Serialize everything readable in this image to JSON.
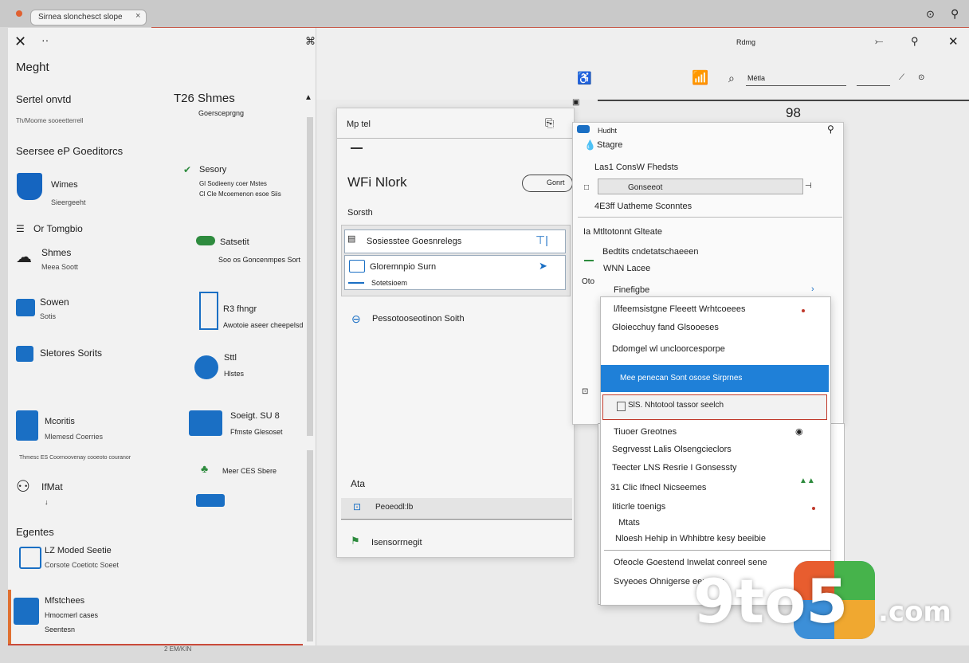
{
  "browser": {
    "tab_title": "Sirnea slonchesct slope"
  },
  "window": {
    "left_title": "Meght",
    "center_title": "Rdmg",
    "search_field": "Métla",
    "right_number": "98"
  },
  "left": {
    "section1_title": "Sertel onvtd",
    "section1_sub": "Th/Moome sooeetterrell",
    "section2_title": "Seersee eP Goeditorcs",
    "items": [
      {
        "title": "Wimes",
        "sub": "Sieergeeht"
      },
      {
        "title": "Or Tomgbio",
        "sub": ""
      },
      {
        "title": "Shmes",
        "sub": "Meea Soott"
      },
      {
        "title": "Sowen",
        "sub": "Sotis"
      },
      {
        "title": "Sletores Sorits",
        "sub": ""
      },
      {
        "title": "Mcoritis",
        "sub": "Mlemesd Coerries"
      },
      {
        "title": "Thmesc ES Coornoovenay cooeoto couranor",
        "sub": ""
      },
      {
        "title": "IfMat",
        "sub": ""
      },
      {
        "title": "Egentes",
        "sub": ""
      },
      {
        "title": "LZ Moded Seetie",
        "sub": "Corsote Coetiotc Soeet"
      },
      {
        "title": "Mfstchees",
        "sub": "Hmocmerl cases"
      },
      {
        "title": "Seentesn",
        "sub": ""
      }
    ],
    "col2_header": "T26 Shmes",
    "col2_sub": "Goersceprgng",
    "col2_items": [
      {
        "title": "Sesory",
        "sub": "Gl Sodieeny coer Mstes",
        "sub2": "Cl Cle Mcoemenon esoe Siis"
      },
      {
        "title": "Satsetit",
        "sub": "Soo os Goncenmpes Sort"
      },
      {
        "title": "R3 fhngr",
        "sub": "Awotoie aseer cheepelsd"
      },
      {
        "title": "Sttl",
        "sub": "Hlstes"
      },
      {
        "title": "Soeigt. SU 8",
        "sub": "Ffmste Glesoset"
      },
      {
        "title": "Meer CES Sbere",
        "sub": ""
      }
    ],
    "bottom_stamp": "2 EM/KIN"
  },
  "dialog": {
    "title": "Mp tel",
    "heading": "WFi Nlork",
    "pill_label": "Gonrt",
    "section_label": "Sorsth",
    "row1": "Sosiesstee Goesnrelegs",
    "row2": "Gloremnpio Surn",
    "row2_sub": "Sotetsioem",
    "plain_row": "Pessotooseotinon Soith",
    "bottom_label": "Ata",
    "bottom_field": "Peoeodl:lb",
    "footer_item": "Isensorrnegit"
  },
  "right_panel": {
    "header_small": "Hudht",
    "header": "Stagre",
    "label1": "Las1 ConsW Fhedsts",
    "field": "Gonseeot",
    "label2": "4E3ff Uatheme Sconntes",
    "label3": "Ia Mtltotonnt Glteate",
    "label4": "Bedtits cndetatschaeeen",
    "label5": "WNN Lacee",
    "label6": "Oto"
  },
  "dropdown": {
    "items": [
      "Finefigbe",
      "l/lfeemsistgne Fleeett Wrhtcoeees",
      "Gloiecchuy fand Glsooeses",
      "Ddomgel wl uncloorcesporpe",
      "Mee penecan Sont  osose Sirprnes",
      "SlS. Nhtotool tassor seelch"
    ],
    "lower_items": [
      "Tiuoer Greotnes",
      "Segrvesst Lalis Olsengcieclors",
      "Teecter LNS Resrie I Gonsessty",
      "31 Clic Ifnecl Nicseemes",
      "Iiticrle toenigs",
      "Mtats",
      "Nloesh Hehip in Whhibtre kesy beeibie",
      "Ofeocle Goestend Inwelat conreel sene",
      "Svyeoes Ohnigerse eenmey"
    ]
  },
  "watermark": {
    "text": "9to5",
    "suffix": ".com"
  },
  "colors": {
    "accent": "#1f80d8",
    "alert": "#c0392b",
    "green": "#2e8b3e",
    "orange": "#e07030"
  }
}
